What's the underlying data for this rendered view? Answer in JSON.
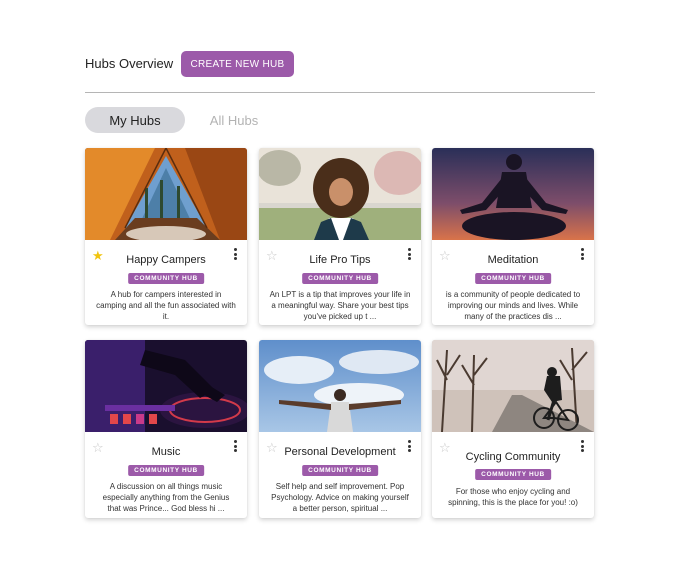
{
  "header": {
    "title": "Hubs Overview",
    "create_button": "CREATE NEW HUB"
  },
  "tabs": [
    {
      "label": "My Hubs",
      "active": true
    },
    {
      "label": "All Hubs",
      "active": false
    }
  ],
  "colors": {
    "accent": "#9c5aa9",
    "star_on": "#f1c40f",
    "star_off": "#c8c8c8",
    "active_tab_bg": "#d9d9dd"
  },
  "hubs": [
    {
      "title": "Happy Campers",
      "badge": "COMMUNITY HUB",
      "favorited": true,
      "description": "A hub for campers interested in camping and all the fun associated with it.",
      "image": "tent-photo"
    },
    {
      "title": "Life Pro Tips",
      "badge": "COMMUNITY HUB",
      "favorited": false,
      "description": "An LPT is a tip that improves your life in a meaningful way. Share your best tips you've picked up t ...",
      "image": "smiling-woman-photo"
    },
    {
      "title": "Meditation",
      "badge": "COMMUNITY HUB",
      "favorited": false,
      "description": "is a community of people dedicated to improving our minds and lives. While many of the practices dis ...",
      "image": "meditation-silhouette-photo"
    },
    {
      "title": "Music",
      "badge": "COMMUNITY HUB",
      "favorited": false,
      "description": "A discussion on all things music especially anything from the Genius that was Prince... God bless hi ...",
      "image": "dj-turntable-photo"
    },
    {
      "title": "Personal Development",
      "badge": "COMMUNITY HUB",
      "favorited": false,
      "description": "Self help and self improvement. Pop Psychology. Advice on making yourself a better person, spiritual ...",
      "image": "arms-outstretched-sky-photo"
    },
    {
      "title": "Cycling Community",
      "badge": "COMMUNITY HUB",
      "favorited": false,
      "description": "For those who enjoy cycling and spinning, this is the place for you! :o)",
      "image": "cyclist-road-photo"
    }
  ]
}
